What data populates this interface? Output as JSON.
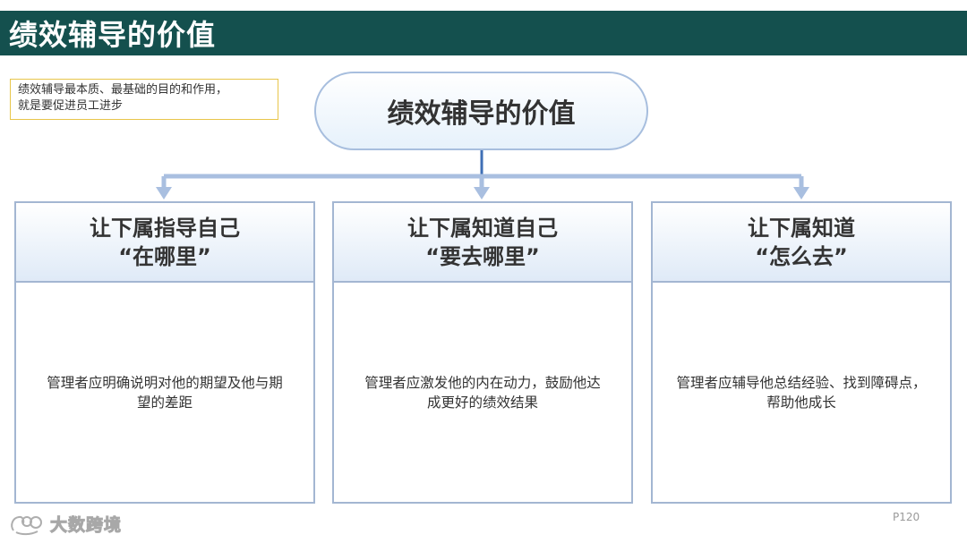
{
  "header": {
    "title": "绩效辅导的价值"
  },
  "note": {
    "line1": "绩效辅导最本质、最基础的目的和作用，",
    "line2": "就是要促进员工进步"
  },
  "central": {
    "label": "绩效辅导的价值"
  },
  "cards": [
    {
      "title_line1": "让下属指导自己",
      "title_line2": "“在哪里”",
      "body_line1": "管理者应明确说明对他的期望及他与期",
      "body_line2": "望的差距"
    },
    {
      "title_line1": "让下属知道自己",
      "title_line2": "“要去哪里”",
      "body_line1": "管理者应激发他的内在动力，鼓励他达",
      "body_line2": "成更好的绩效结果"
    },
    {
      "title_line1": "让下属知道",
      "title_line2": "“怎么去”",
      "body_line1": "管理者应辅导他总结经验、找到障碍点，",
      "body_line2": "帮助他成长"
    }
  ],
  "watermark": {
    "text": "大数跨境"
  },
  "footer": {
    "page": "P120"
  },
  "colors": {
    "title_bar": "#14504e",
    "connector": "#a9bfe0",
    "card_border": "#a3b6d2",
    "note_border": "#e8c64a"
  }
}
